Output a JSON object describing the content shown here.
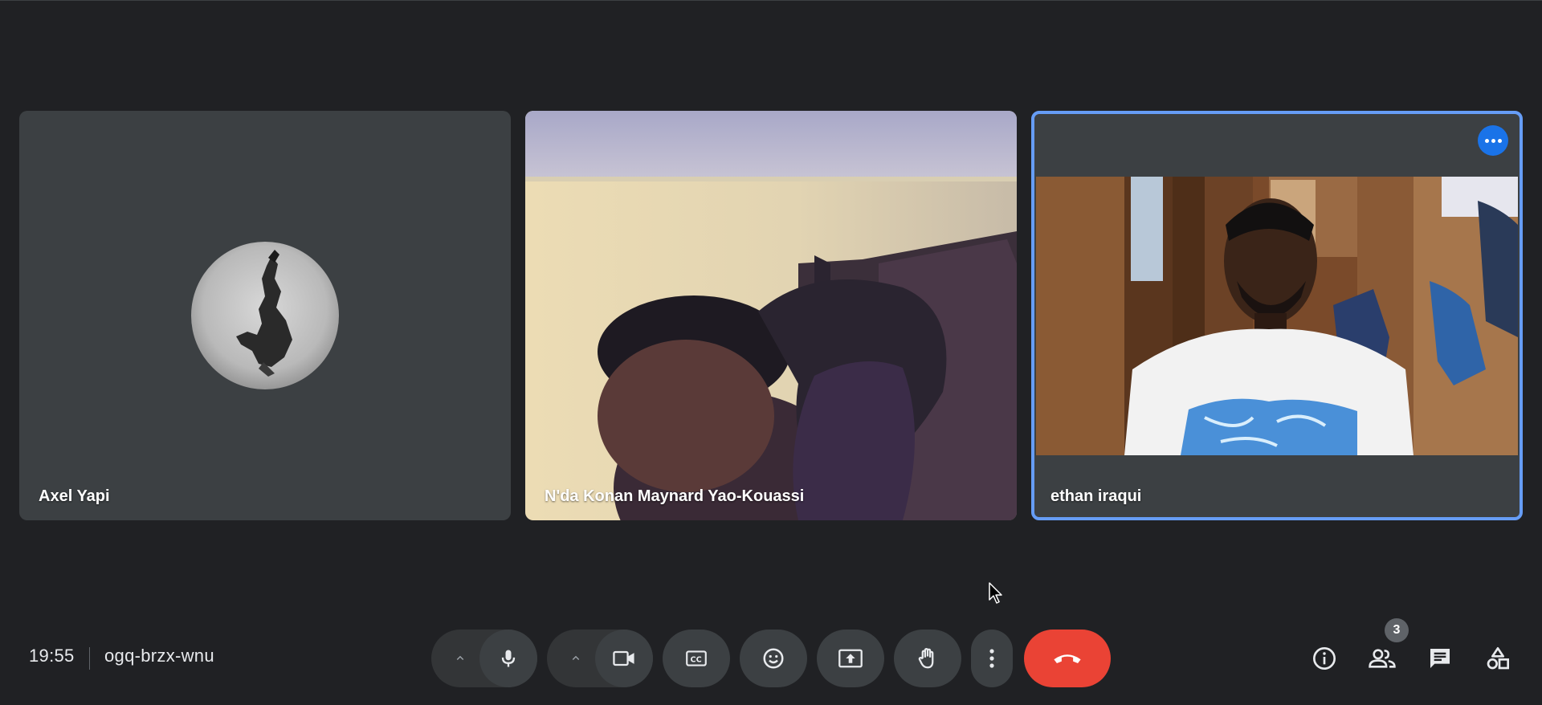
{
  "participants": [
    {
      "name": "Axel Yapi",
      "video": "off",
      "avatar": "avatar-photo"
    },
    {
      "name": "N'da Konan Maynard Yao-Kouassi",
      "video": "on"
    },
    {
      "name": "ethan iraqui",
      "video": "on",
      "active_speaker": true
    }
  ],
  "meeting": {
    "time": "19:55",
    "code": "ogq-brzx-wnu"
  },
  "controls": {
    "mic_options_icon": "chevron-up-icon",
    "mic_icon": "microphone-icon",
    "camera_options_icon": "chevron-up-icon",
    "camera_icon": "videocam-icon",
    "captions_icon": "closed-captions-icon",
    "reactions_icon": "emoji-icon",
    "present_icon": "present-screen-icon",
    "raise_hand_icon": "hand-icon",
    "more_icon": "more-vert-icon",
    "leave_icon": "call-end-icon"
  },
  "side_controls": {
    "info_icon": "info-icon",
    "people_icon": "people-icon",
    "people_count": "3",
    "chat_icon": "chat-icon",
    "activities_icon": "shapes-icon"
  },
  "colors": {
    "background": "#202124",
    "tile": "#3c4043",
    "control": "#3c4043",
    "active_border": "#669df6",
    "accent": "#1a73e8",
    "hangup": "#ea4335"
  }
}
